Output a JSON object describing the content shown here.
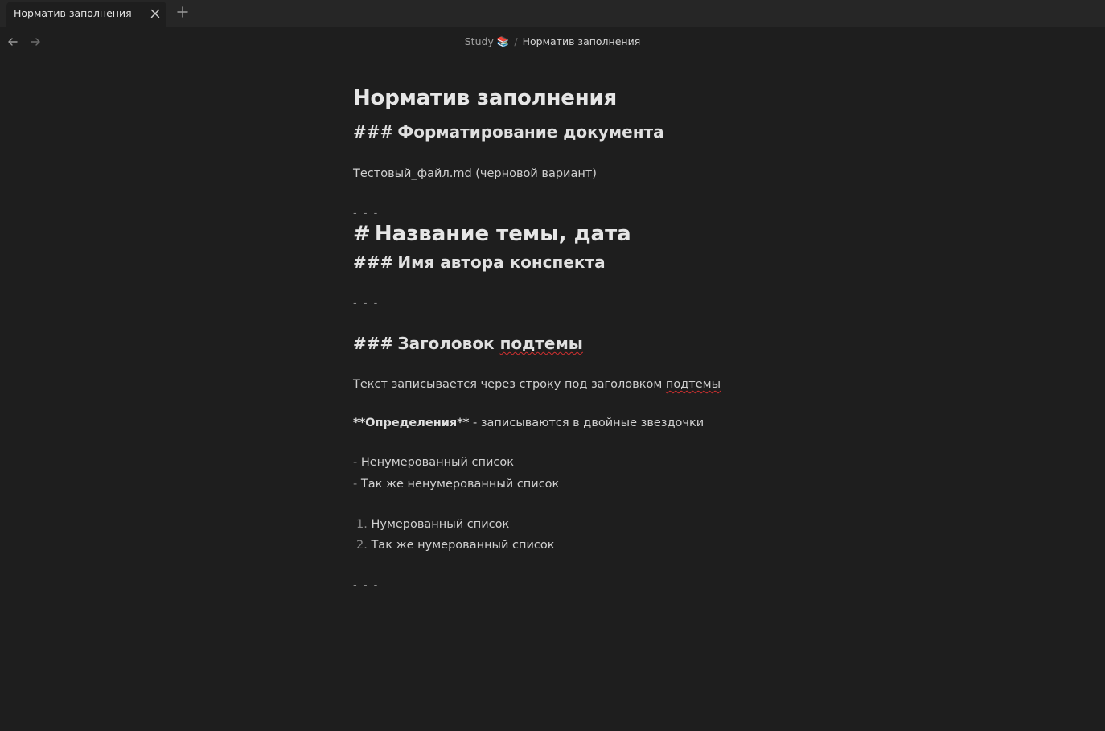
{
  "tab": {
    "title": "Норматив заполнения"
  },
  "breadcrumb": {
    "parent": "Study 📚",
    "separator": "/",
    "current": "Норматив заполнения"
  },
  "note": {
    "title": "Норматив заполнения",
    "lines": {
      "h3_format_hash": "###",
      "h3_format_text": "Форматирование документа",
      "file_line": "Тестовый_файл.md (черновой вариант)",
      "hr1": "- - -",
      "h1_hash": "#",
      "h1_text": "Название темы, дата",
      "h3_author_hash": "###",
      "h3_author_text": "Имя автора конспекта",
      "hr2": "- - -",
      "h3_sub_hash": "###",
      "h3_sub_text_a": "Заголовок ",
      "h3_sub_text_b": "подтемы",
      "text_line_a": "Текст записывается через строку под заголовком ",
      "text_line_b": "подтемы",
      "def_bold": "**Определения**",
      "def_rest": " - записываются в двойные звездочки",
      "bullet_mark": "-",
      "bullet1": "Ненумерованный список",
      "bullet2": "Так же ненумерованный список",
      "num1_mark": "1.",
      "num1": "Нумерованный список",
      "num2_mark": "2.",
      "num2": "Так же нумерованный список",
      "hr3": "- - -"
    }
  },
  "icons": {
    "close": "close-icon",
    "new_tab": "plus-icon",
    "back": "arrow-left-icon",
    "forward": "arrow-right-icon"
  },
  "colors": {
    "background": "#1e1e1e",
    "tabbar": "#262626",
    "markup_gray": "#8a8a8a",
    "spellcheck": "#d03030"
  }
}
